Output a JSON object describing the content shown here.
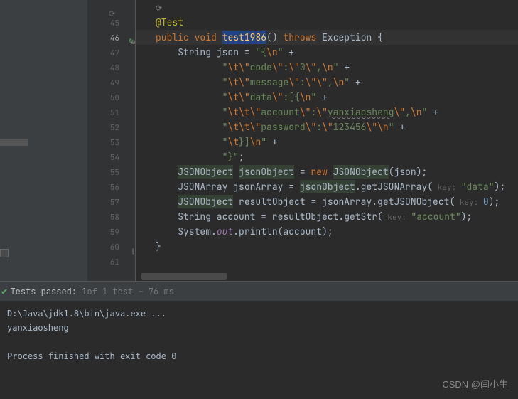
{
  "gutter": {
    "lines": [
      "",
      "45",
      "46",
      "47",
      "48",
      "49",
      "50",
      "51",
      "52",
      "53",
      "54",
      "55",
      "56",
      "57",
      "58",
      "59",
      "60",
      "61"
    ],
    "current": "46"
  },
  "code": {
    "annotation": "@Test",
    "sig": {
      "kw1": "public",
      "kw2": "void",
      "name": "test1986",
      "parens": "()",
      "kw3": "throws",
      "exc": "Exception",
      "brace": "{"
    },
    "l47": {
      "pre": "String json = ",
      "s1": "\"",
      "e1": "{",
      "e2": "\\n",
      "s2": "\"",
      "op": " +"
    },
    "l48": {
      "s1": "\"",
      "e1": "\\t\\\"",
      "txt": "code",
      "e2": "\\\"",
      "c": ":",
      "e3": "\\\"",
      "v": "0",
      "e4": "\\\"",
      "cm": ",",
      "e5": "\\n",
      "s2": "\"",
      "op": " +"
    },
    "l49": {
      "s1": "\"",
      "e1": "\\t\\\"",
      "txt": "message",
      "e2": "\\\"",
      "c": ":",
      "e3": "\\\"\\\"",
      "cm": ",",
      "e5": "\\n",
      "s2": "\"",
      "op": " +"
    },
    "l50": {
      "s1": "\"",
      "e1": "\\t\\\"",
      "txt": "data",
      "e2": "\\\"",
      "c": ":[{",
      "e5": "\\n",
      "s2": "\"",
      "op": " +"
    },
    "l51": {
      "s1": "\"",
      "e1": "\\t\\t\\\"",
      "txt": "account",
      "e2": "\\\"",
      "c": ":",
      "e3": "\\\"",
      "v": "yanxiaosheng",
      "e4": "\\\"",
      "cm": ",",
      "e5": "\\n",
      "s2": "\"",
      "op": " +"
    },
    "l52": {
      "s1": "\"",
      "e1": "\\t\\t\\\"",
      "txt": "password",
      "e2": "\\\"",
      "c": ":",
      "e3": "\\\"",
      "v": "123456",
      "e4": "\\\"",
      "e5": "\\n",
      "s2": "\"",
      "op": " +"
    },
    "l53": {
      "s1": "\"",
      "e1": "\\t",
      "txt": "}]",
      "e5": "\\n",
      "s2": "\"",
      "op": " +"
    },
    "l54": {
      "s1": "\"",
      "txt": "}",
      "s2": "\"",
      "semi": ";"
    },
    "l55": {
      "cls1": "JSONObject",
      "var1": "jsonObject",
      "eq": " = ",
      "kw": "new",
      "sp": " ",
      "cls2": "JSONObject",
      "p1": "(",
      "arg": "json",
      "p2": ")",
      "semi": ";"
    },
    "l56": {
      "cls": "JSONArray",
      "var": "jsonArray",
      "eq": " = ",
      "obj": "jsonObject",
      "dot": ".",
      "m": "getJSONArray",
      "p1": "(",
      "hint": " key: ",
      "arg": "\"data\"",
      "p2": ")",
      "semi": ";"
    },
    "l57": {
      "cls": "JSONObject",
      "var": "resultObject",
      "eq": " = jsonArray.getJSONObject(",
      "hint": " key: ",
      "arg": "0",
      "p2": ")",
      "semi": ";"
    },
    "l58": {
      "txt1": "String account = resultObject.getStr(",
      "hint": " key: ",
      "arg": "\"account\"",
      "p2": ")",
      "semi": ";"
    },
    "l59": {
      "txt1": "System.",
      "out": "out",
      "txt2": ".println(account)",
      "semi": ";"
    },
    "l60": {
      "brace": "}"
    }
  },
  "testStatus": {
    "passed": "Tests passed: 1",
    "detail": " of 1 test – 76 ms"
  },
  "console": {
    "line1": "D:\\Java\\jdk1.8\\bin\\java.exe ...",
    "line2": "yanxiaosheng",
    "line3": "",
    "line4": "Process finished with exit code 0"
  },
  "watermark": "CSDN @闫小生"
}
